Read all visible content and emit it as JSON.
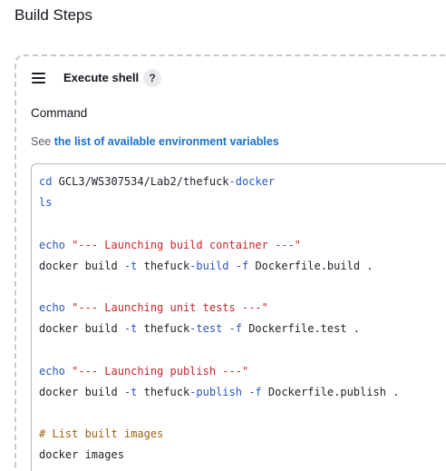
{
  "section": {
    "title": "Build Steps"
  },
  "step": {
    "title": "Execute shell",
    "help_icon_glyph": "?",
    "command_label": "Command",
    "env_prefix": "See ",
    "env_link": "the list of available environment variables"
  },
  "colors": {
    "link": "#1a70c7",
    "string": "#c4262b",
    "keyword": "#2b58b8",
    "comment": "#a0610d",
    "card_border": "#c8c8ce"
  },
  "icons": {
    "drag_handle": "hamburger-drag-icon",
    "help": "question-circle-icon"
  },
  "command_lines": [
    [
      {
        "t": "cd",
        "c": "kw"
      },
      {
        "t": " GCL3/WS307534/Lab2/thefuck",
        "c": "cmd"
      },
      {
        "t": "-",
        "c": "op"
      },
      {
        "t": "docker",
        "c": "kw"
      }
    ],
    [
      {
        "t": "ls",
        "c": "kw"
      }
    ],
    [],
    [
      {
        "t": "echo",
        "c": "kw"
      },
      {
        "t": " ",
        "c": "cmd"
      },
      {
        "t": "\"--- Launching build container ---\"",
        "c": "str"
      }
    ],
    [
      {
        "t": "docker build ",
        "c": "cmd"
      },
      {
        "t": "-t",
        "c": "flag"
      },
      {
        "t": " thefuck",
        "c": "cmd"
      },
      {
        "t": "-build",
        "c": "flag"
      },
      {
        "t": " ",
        "c": "cmd"
      },
      {
        "t": "-f",
        "c": "flag"
      },
      {
        "t": " Dockerfile.build .",
        "c": "cmd"
      }
    ],
    [],
    [
      {
        "t": "echo",
        "c": "kw"
      },
      {
        "t": " ",
        "c": "cmd"
      },
      {
        "t": "\"--- Launching unit tests ---\"",
        "c": "str"
      }
    ],
    [
      {
        "t": "docker build ",
        "c": "cmd"
      },
      {
        "t": "-t",
        "c": "flag"
      },
      {
        "t": " thefuck",
        "c": "cmd"
      },
      {
        "t": "-test",
        "c": "flag"
      },
      {
        "t": " ",
        "c": "cmd"
      },
      {
        "t": "-f",
        "c": "flag"
      },
      {
        "t": " Dockerfile.test .",
        "c": "cmd"
      }
    ],
    [],
    [
      {
        "t": "echo",
        "c": "kw"
      },
      {
        "t": " ",
        "c": "cmd"
      },
      {
        "t": "\"--- Launching publish ---\"",
        "c": "str"
      }
    ],
    [
      {
        "t": "docker build ",
        "c": "cmd"
      },
      {
        "t": "-t",
        "c": "flag"
      },
      {
        "t": " thefuck",
        "c": "cmd"
      },
      {
        "t": "-publish",
        "c": "flag"
      },
      {
        "t": " ",
        "c": "cmd"
      },
      {
        "t": "-f",
        "c": "flag"
      },
      {
        "t": " Dockerfile.publish .",
        "c": "cmd"
      }
    ],
    [],
    [
      {
        "t": "# List built images",
        "c": "comment"
      }
    ],
    [
      {
        "t": "docker images",
        "c": "cmd"
      }
    ]
  ]
}
